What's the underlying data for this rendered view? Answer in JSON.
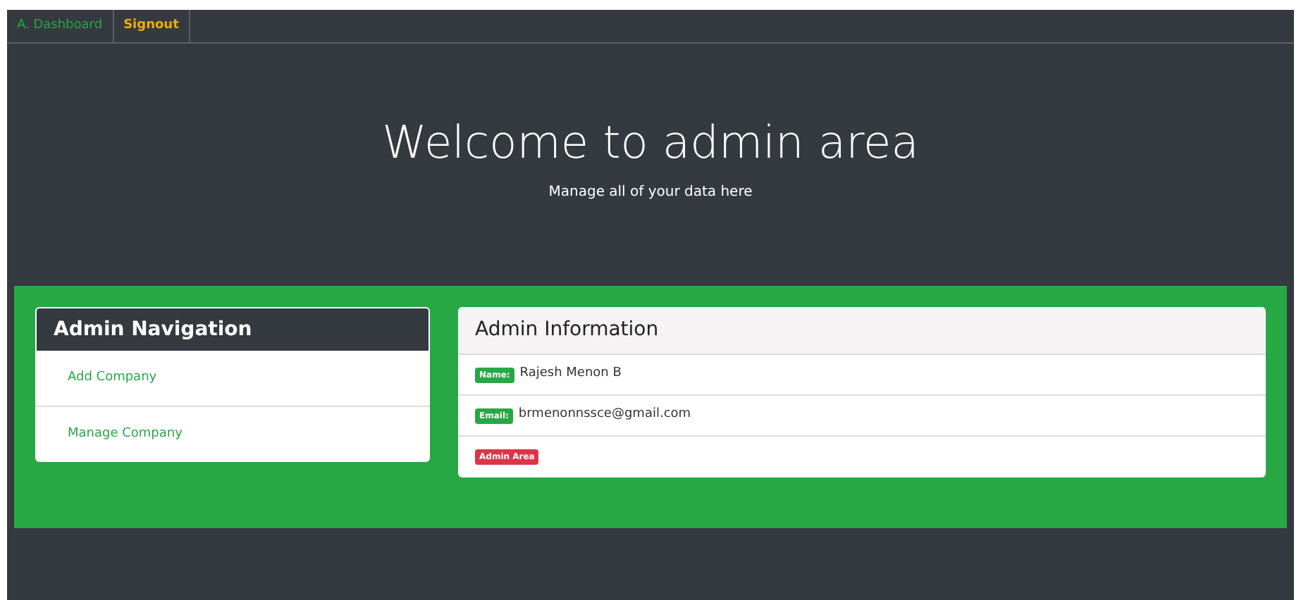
{
  "navbar": {
    "items": [
      {
        "label": "A. Dashboard",
        "kind": "success"
      },
      {
        "label": "Signout",
        "kind": "warning"
      }
    ]
  },
  "hero": {
    "title": "Welcome to admin area",
    "subtitle": "Manage all of your data here"
  },
  "admin_navigation": {
    "title": "Admin Navigation",
    "items": [
      "Add Company",
      "Manage Company"
    ]
  },
  "admin_information": {
    "title": "Admin Information",
    "rows": [
      {
        "badge": "Name:",
        "kind": "success",
        "value": "Rajesh Menon B"
      },
      {
        "badge": "Email:",
        "kind": "success",
        "value": "brmenonnssce@gmail.com"
      },
      {
        "badge": "Admin Area",
        "kind": "danger"
      }
    ]
  }
}
